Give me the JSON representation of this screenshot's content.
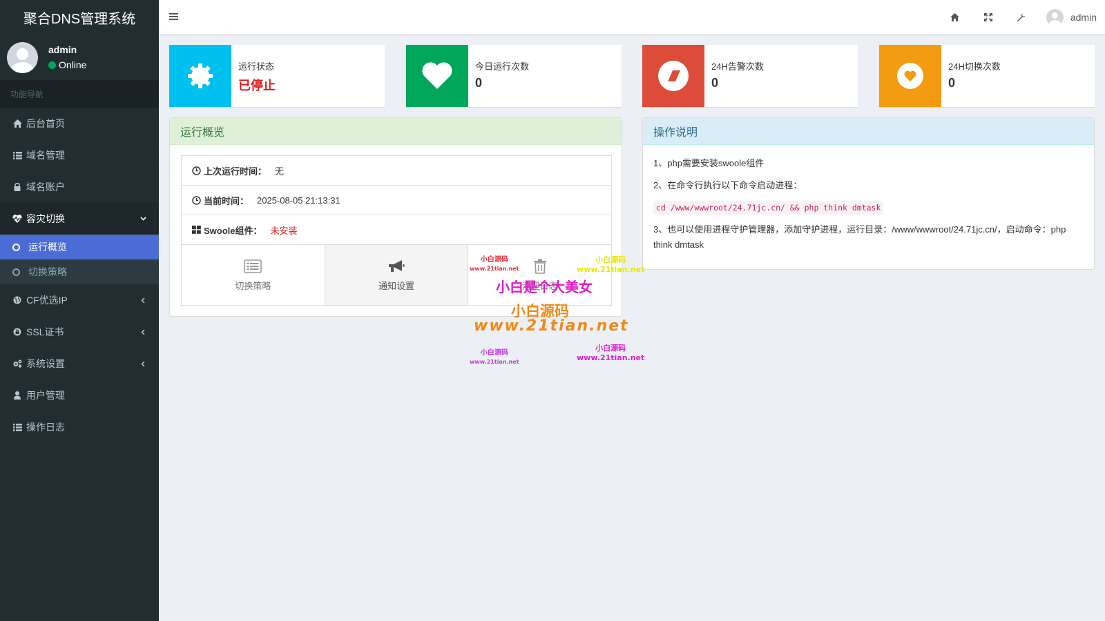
{
  "app": {
    "title": "聚合DNS管理系统"
  },
  "user": {
    "name": "admin",
    "status": "Online"
  },
  "nav": {
    "header": "功能导航",
    "items": [
      {
        "label": "后台首页",
        "icon": "home-icon"
      },
      {
        "label": "域名管理",
        "icon": "list-icon"
      },
      {
        "label": "域名账户",
        "icon": "lock-icon"
      },
      {
        "label": "容灾切换",
        "icon": "heartbeat-icon",
        "expanded": true
      },
      {
        "label": "CF优选IP",
        "icon": "globe-icon"
      },
      {
        "label": "SSL证书",
        "icon": "lock-icon"
      },
      {
        "label": "系统设置",
        "icon": "gears-icon"
      },
      {
        "label": "用户管理",
        "icon": "user-icon"
      },
      {
        "label": "操作日志",
        "icon": "list-icon"
      }
    ],
    "submenu": [
      {
        "label": "运行概览",
        "active": true
      },
      {
        "label": "切换策略",
        "active": false
      }
    ]
  },
  "header": {
    "username": "admin"
  },
  "stats": [
    {
      "label": "运行状态",
      "value": "已停止",
      "color": "#00c0ef",
      "icon": "gear-icon"
    },
    {
      "label": "今日运行次数",
      "value": "0",
      "color": "#00a65a",
      "icon": "heart-icon"
    },
    {
      "label": "24H告警次数",
      "value": "0",
      "color": "#dd4b39",
      "icon": "eraser-icon"
    },
    {
      "label": "24H切换次数",
      "value": "0",
      "color": "#f39c12",
      "icon": "heart-circle-icon"
    }
  ],
  "overview": {
    "title": "运行概览",
    "last_run_key": "上次运行时间：",
    "last_run_value": "无",
    "current_time_key": "当前时间：",
    "current_time_value": "2025-08-05 21:13:31",
    "swoole_key": "Swoole组件：",
    "swoole_value": "未安装",
    "buttons": [
      {
        "label": "切换策略",
        "icon": "list-alt-icon"
      },
      {
        "label": "通知设置",
        "icon": "bullhorn-icon"
      },
      {
        "label": "清理日志",
        "icon": "trash-icon"
      }
    ]
  },
  "instructions": {
    "title": "操作说明",
    "step1": "1、php需要安装swoole组件",
    "step2": "2、在命令行执行以下命令启动进程：",
    "command": "cd /www/wwwroot/24.71jc.cn/ && php think dmtask",
    "step3": "3、也可以使用进程守护管理器，添加守护进程，运行目录：/www/wwwroot/24.71jc.cn/，启动命令：php think dmtask"
  },
  "watermark": {
    "small_cn": "小白源码",
    "small_url": "www.21tian.net",
    "big_cn": "小白源码",
    "big_url": "www.21tian.net",
    "slogan": "小白是个大美女"
  }
}
